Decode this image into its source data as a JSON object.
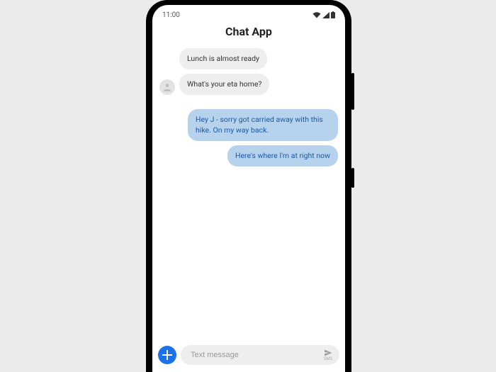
{
  "statusbar": {
    "time": "11:00"
  },
  "header": {
    "title": "Chat App"
  },
  "messages": {
    "m0": "Lunch is almost ready",
    "m1": "What's your eta home?",
    "m2": "Hey J - sorry got carried away with this hike. On my way back.",
    "m3": "Here's where I'm at right now"
  },
  "composer": {
    "placeholder": "Text message",
    "send_label": "SMS"
  }
}
